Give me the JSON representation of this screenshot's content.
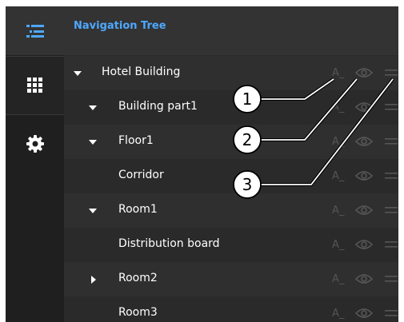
{
  "header": {
    "title": "Navigation Tree"
  },
  "rail": {
    "top_icon": "list-tree-icon",
    "items": [
      {
        "name": "apps-grid-icon"
      },
      {
        "name": "gear-icon"
      }
    ]
  },
  "tree": {
    "rows": [
      {
        "label": "Hotel Building",
        "caret": "down",
        "a_label": "A_"
      },
      {
        "label": "Building part1",
        "caret": "down",
        "a_label": "A_"
      },
      {
        "label": "Floor1",
        "caret": "down",
        "a_label": "A_"
      },
      {
        "label": "Corridor",
        "caret": "none",
        "a_label": "A_"
      },
      {
        "label": "Room1",
        "caret": "down",
        "a_label": "A_"
      },
      {
        "label": "Distribution board",
        "caret": "none",
        "a_label": "A_"
      },
      {
        "label": "Room2",
        "caret": "right",
        "a_label": "A_"
      },
      {
        "label": "Room3",
        "caret": "none",
        "a_label": "A_"
      }
    ]
  },
  "callouts": [
    "1",
    "2",
    "3"
  ],
  "colors": {
    "accent": "#4ea8ff",
    "background": "#2b2b2b",
    "icon_muted": "#555555"
  }
}
